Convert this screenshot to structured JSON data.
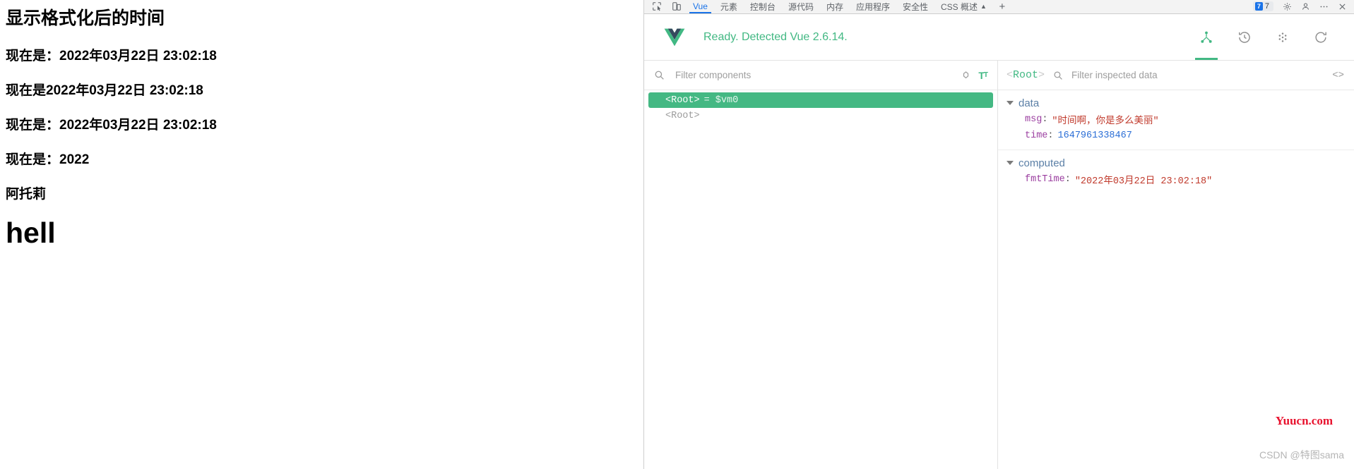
{
  "page": {
    "heading": "显示格式化后的时间",
    "lines": [
      "现在是：2022年03月22日 23:02:18",
      "现在是2022年03月22日 23:02:18",
      "现在是：2022年03月22日 23:02:18",
      "现在是：2022",
      "阿托莉"
    ],
    "big_heading": "hell"
  },
  "devtools": {
    "tabbar": {
      "tools": [
        "inspect-element-icon",
        "device-toolbar-icon"
      ],
      "tabs": [
        {
          "label": "Vue",
          "active": true
        },
        {
          "label": "元素",
          "active": false
        },
        {
          "label": "控制台",
          "active": false
        },
        {
          "label": "源代码",
          "active": false
        },
        {
          "label": "内存",
          "active": false
        },
        {
          "label": "应用程序",
          "active": false
        },
        {
          "label": "安全性",
          "active": false
        },
        {
          "label": "CSS 概述",
          "active": false,
          "warning": "▲"
        }
      ],
      "more_tabs_label": "+",
      "issues_chip": "7",
      "issues_count": "7",
      "right_icons": [
        "gear-icon",
        "customize-icon",
        "more-options-icon",
        "close-icon"
      ]
    },
    "vue_header": {
      "status": "Ready. Detected Vue 2.6.14.",
      "actions": [
        {
          "name": "components-tab-icon",
          "active": true
        },
        {
          "name": "timeline-tab-icon",
          "active": false
        },
        {
          "name": "settings-tab-icon",
          "active": false
        },
        {
          "name": "refresh-icon",
          "active": false
        }
      ]
    },
    "tree_pane": {
      "filter_placeholder": "Filter components",
      "filter_value": "",
      "select_icon": "target-icon",
      "text_size_icon": "Tt",
      "rows": [
        {
          "tag": "<Root>",
          "ref": "= $vm0",
          "selected": true
        },
        {
          "tag": "<Root>",
          "ref": "",
          "selected": false
        }
      ]
    },
    "inspector": {
      "root_label": "<Root>",
      "root_open": "<",
      "root_name": "Root",
      "root_close": ">",
      "filter_placeholder": "Filter inspected data",
      "filter_value": "",
      "code_toggle": "<>",
      "groups": [
        {
          "name": "data",
          "rows": [
            {
              "key": "msg",
              "value": "\"时间啊，你是多么美丽\"",
              "type": "string"
            },
            {
              "key": "time",
              "value": "1647961338467",
              "type": "number"
            }
          ]
        },
        {
          "name": "computed",
          "rows": [
            {
              "key": "fmtTime",
              "value": "\"2022年03月22日 23:02:18\"",
              "type": "string"
            }
          ]
        }
      ]
    }
  },
  "watermarks": {
    "yuucn": "Yuucn.com",
    "csdn": "CSDN @特图sama"
  },
  "colors": {
    "vue_green": "#42b883",
    "chrome_blue": "#1a73e8",
    "string_red": "#c0392b",
    "number_blue": "#2c6fd6",
    "key_purple": "#9b3fa0"
  }
}
